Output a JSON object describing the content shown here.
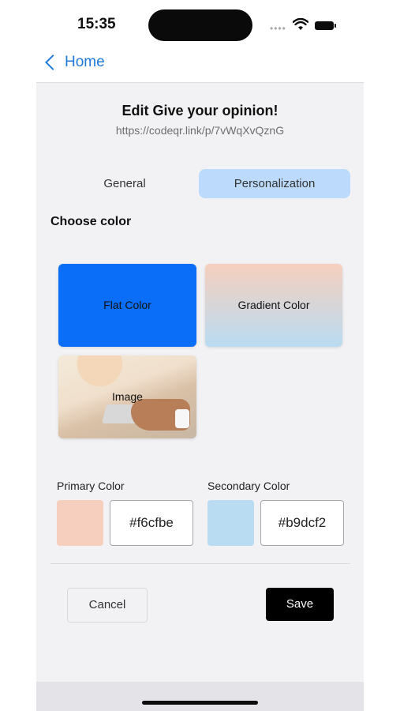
{
  "status": {
    "time": "15:35"
  },
  "nav": {
    "back_label": "Home"
  },
  "header": {
    "title": "Edit Give your opinion!",
    "subtitle": "https://codeqr.link/p/7vWqXvQznG"
  },
  "tabs": [
    {
      "label": "General",
      "active": false
    },
    {
      "label": "Personalization",
      "active": true
    }
  ],
  "choose_color": {
    "label": "Choose color",
    "options": [
      {
        "label": "Flat Color"
      },
      {
        "label": "Gradient Color"
      },
      {
        "label": "Image"
      }
    ]
  },
  "colors": {
    "primary": {
      "label": "Primary Color",
      "value": "#f6cfbe"
    },
    "secondary": {
      "label": "Secondary Color",
      "value": "#b9dcf2"
    }
  },
  "actions": {
    "cancel": "Cancel",
    "save": "Save"
  },
  "theme": {
    "accent": "#1f7ad9",
    "tab_active": "#bcdafb",
    "flat_color": "#0a6ef9"
  }
}
